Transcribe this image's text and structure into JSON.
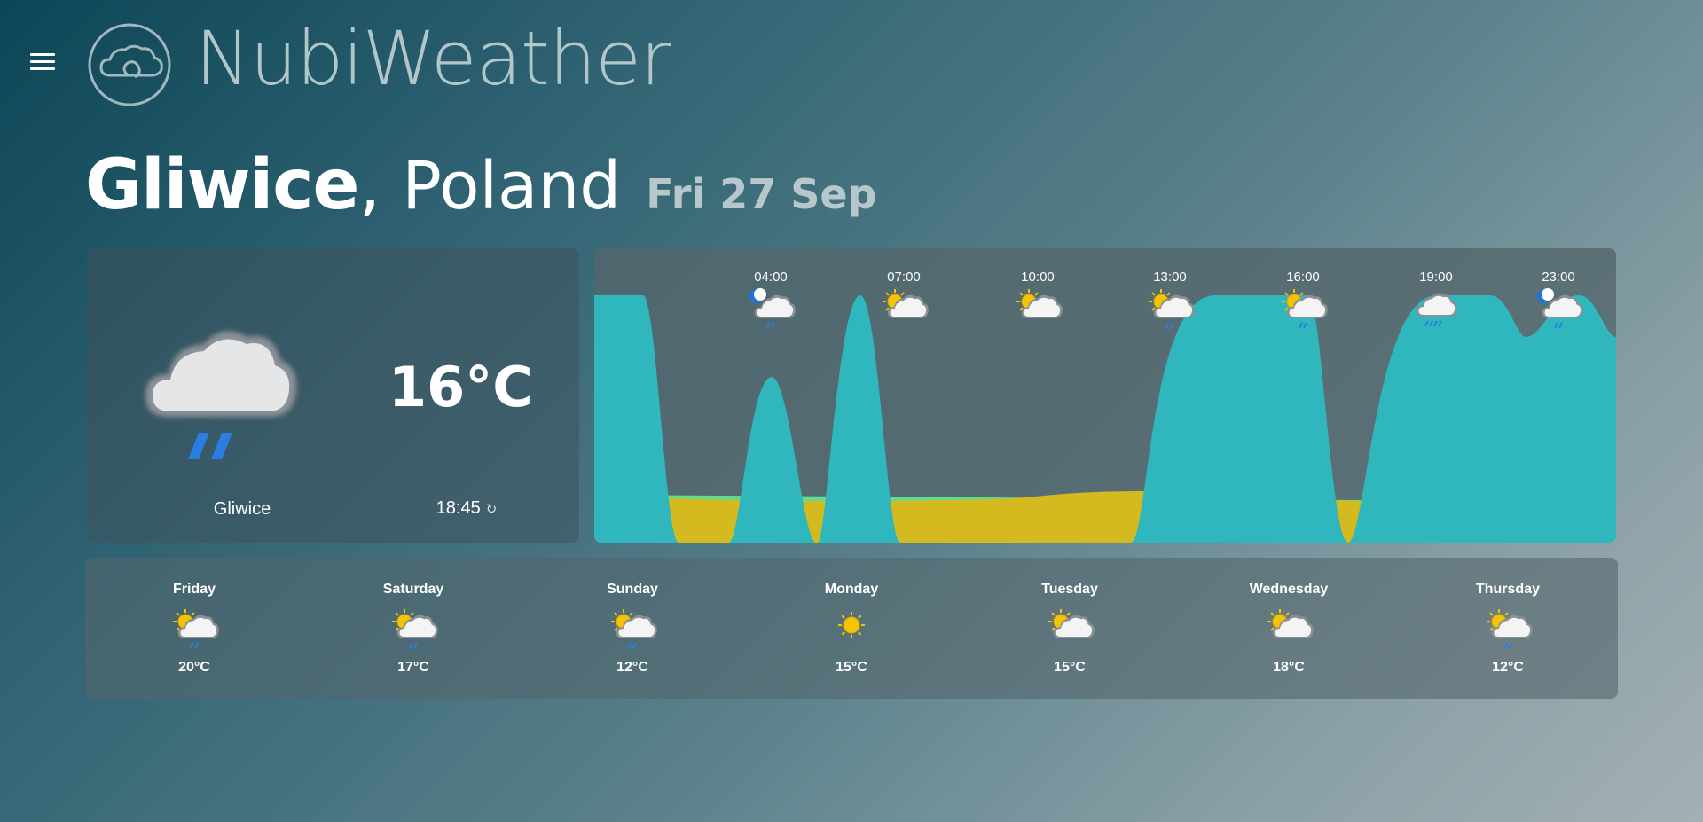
{
  "header": {
    "menu_icon": "hamburger-menu-icon",
    "logo_icon": "cloud-logo-icon",
    "app_title": "NubiWeather"
  },
  "location": {
    "city": "Gliwice",
    "separator": ",",
    "country": "Poland",
    "date": "Fri 27 Sep"
  },
  "current": {
    "icon": "cloud-rain-icon",
    "temperature": "16°C",
    "city": "Gliwice",
    "time": "18:45",
    "refresh_icon": "refresh-icon"
  },
  "hourly": {
    "times": [
      {
        "label": "04:00",
        "icon": "night-cloud-rain-icon"
      },
      {
        "label": "07:00",
        "icon": "sun-cloud-icon"
      },
      {
        "label": "10:00",
        "icon": "sun-cloud-icon"
      },
      {
        "label": "13:00",
        "icon": "sun-cloud-rain-icon"
      },
      {
        "label": "16:00",
        "icon": "sun-cloud-rain-icon"
      },
      {
        "label": "19:00",
        "icon": "cloud-drizzle-icon"
      },
      {
        "label": "23:00",
        "icon": "night-cloud-rain-icon"
      }
    ]
  },
  "daily": [
    {
      "day": "Friday",
      "temp": "20°C",
      "icon": "sun-cloud-rain-icon"
    },
    {
      "day": "Saturday",
      "temp": "17°C",
      "icon": "sun-cloud-rain-icon"
    },
    {
      "day": "Sunday",
      "temp": "12°C",
      "icon": "sun-cloud-rain-icon"
    },
    {
      "day": "Monday",
      "temp": "15°C",
      "icon": "sun-icon"
    },
    {
      "day": "Tuesday",
      "temp": "15°C",
      "icon": "sun-cloud-icon"
    },
    {
      "day": "Wednesday",
      "temp": "18°C",
      "icon": "sun-cloud-icon"
    },
    {
      "day": "Thursday",
      "temp": "12°C",
      "icon": "sun-cloud-rain-icon"
    }
  ],
  "colors": {
    "cloud_cover": "#2fb7bd",
    "precipitation": "#d4b91f",
    "ground": "#64dc8e",
    "rain": "#2a7de1",
    "sun": "#f5c400"
  }
}
